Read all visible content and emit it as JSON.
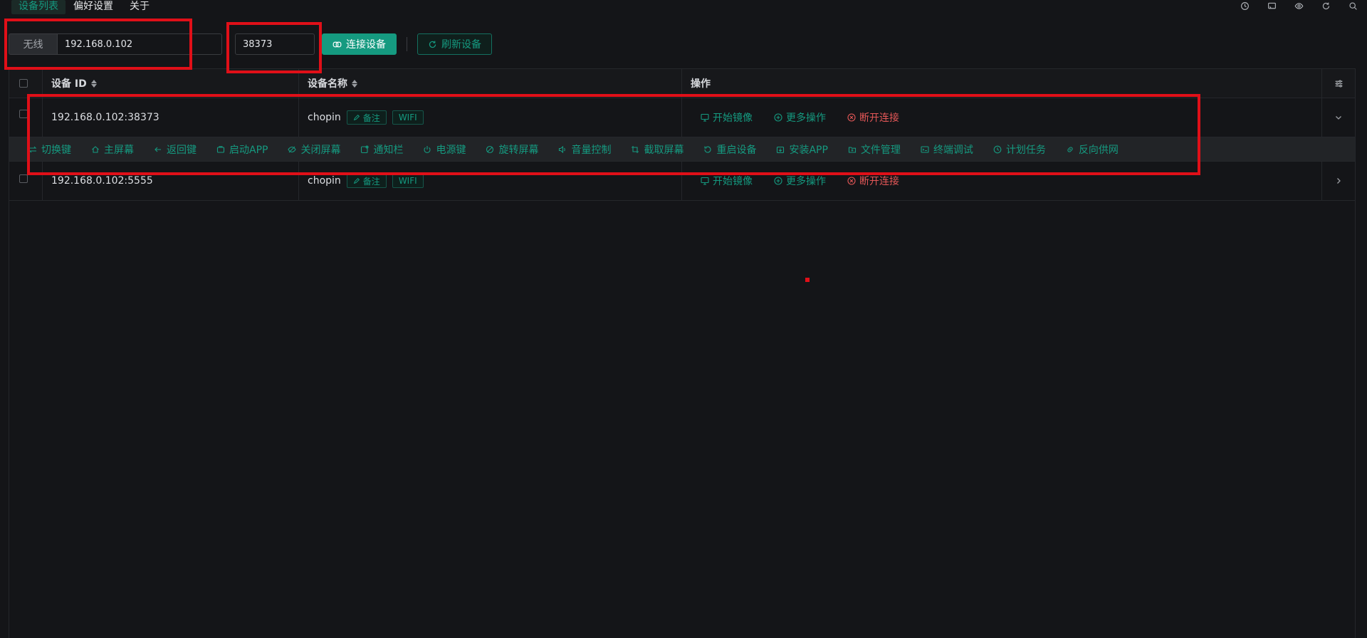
{
  "tabs": [
    {
      "label": "设备列表",
      "active": true
    },
    {
      "label": "偏好设置",
      "active": false
    },
    {
      "label": "关于",
      "active": false
    }
  ],
  "window_icons": [
    "clock-icon",
    "screen-cast-icon",
    "eye-icon",
    "refresh-icon",
    "search-icon"
  ],
  "toolbar": {
    "mode_tag": "无线",
    "ip_value": "192.168.0.102",
    "port_value": "38373",
    "connect_label": "连接设备",
    "refresh_label": "刷新设备"
  },
  "table": {
    "columns": {
      "device_id": "设备 ID",
      "device_name": "设备名称",
      "actions": "操作"
    },
    "rows": [
      {
        "id": "192.168.0.102:38373",
        "name": "chopin",
        "note_label": "备注",
        "type_tag": "WIFI",
        "expanded": true,
        "actions": {
          "mirror": "开始镜像",
          "more": "更多操作",
          "disconnect": "断开连接"
        }
      },
      {
        "id": "192.168.0.102:5555",
        "name": "chopin",
        "note_label": "备注",
        "type_tag": "WIFI",
        "expanded": false,
        "actions": {
          "mirror": "开始镜像",
          "more": "更多操作",
          "disconnect": "断开连接"
        }
      }
    ],
    "quick_actions": [
      "切换键",
      "主屏幕",
      "返回键",
      "启动APP",
      "关闭屏幕",
      "通知栏",
      "电源键",
      "旋转屏幕",
      "音量控制",
      "截取屏幕",
      "重启设备",
      "安装APP",
      "文件管理",
      "终端调试",
      "计划任务",
      "反向供网"
    ]
  },
  "colors": {
    "accent": "#159a80",
    "danger": "#e35757",
    "background": "#141518",
    "annotation": "#e00f18"
  }
}
